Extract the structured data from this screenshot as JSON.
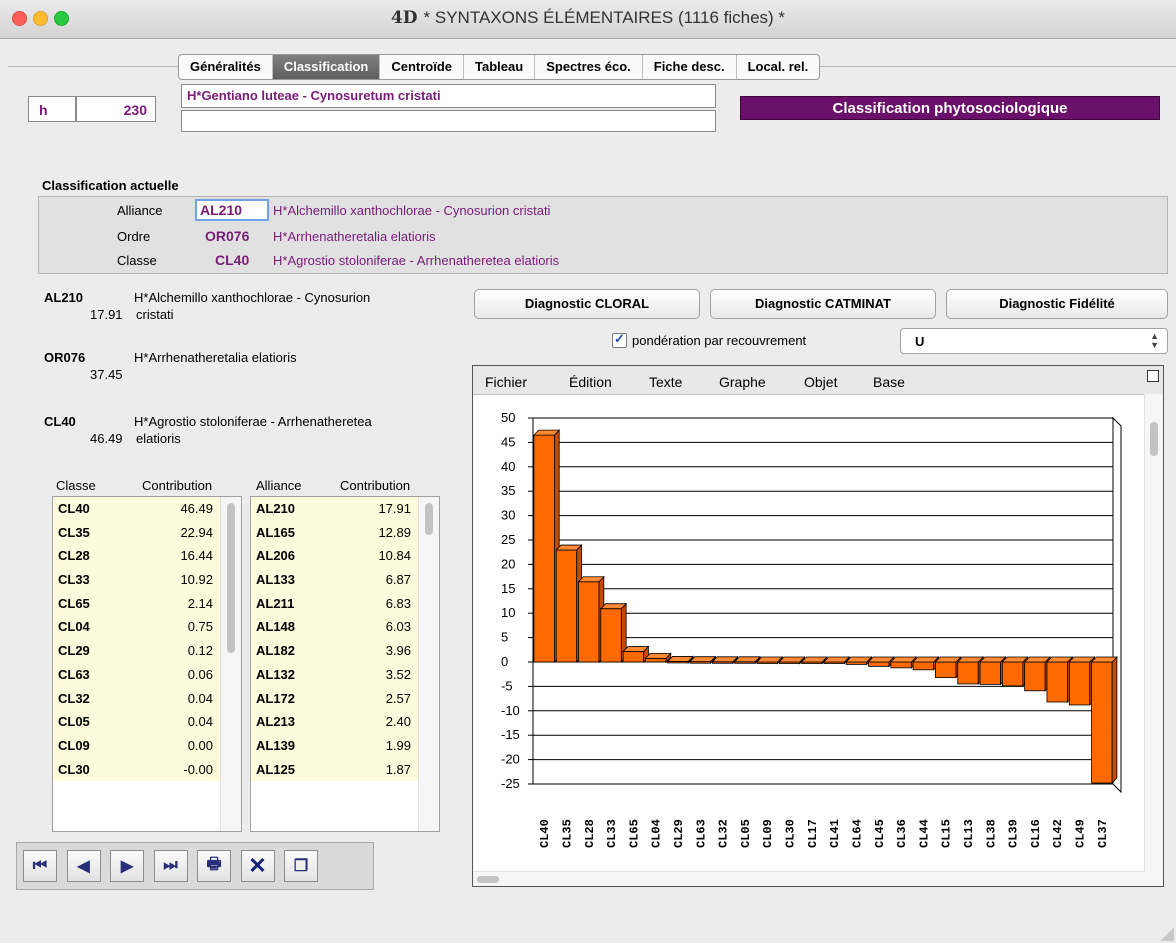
{
  "window": {
    "title": "* SYNTAXONS ÉLÉMENTAIRES (1116 fiches) *",
    "logo": "4D"
  },
  "tabs": [
    {
      "label": "Généralités",
      "active": false
    },
    {
      "label": "Classification",
      "active": true
    },
    {
      "label": "Centroïde",
      "active": false
    },
    {
      "label": "Tableau",
      "active": false
    },
    {
      "label": "Spectres éco.",
      "active": false
    },
    {
      "label": "Fiche desc.",
      "active": false
    },
    {
      "label": "Local. rel.",
      "active": false
    }
  ],
  "record": {
    "prefix": "h",
    "number": "230",
    "name": "H*Gentiano luteae - Cynosuretum cristati",
    "name2": ""
  },
  "banner": "Classification phytosociologique",
  "current": {
    "heading": "Classification actuelle",
    "alliance": {
      "label": "Alliance",
      "code": "AL210",
      "name": "H*Alchemillo xanthochlorae - Cynosurion cristati"
    },
    "ordre": {
      "label": "Ordre",
      "code": "OR076",
      "name": "H*Arrhenatheretalia elatioris"
    },
    "classe": {
      "label": "Classe",
      "code": "CL40",
      "name": "H*Agrostio stoloniferae - Arrhenatheretea elatioris"
    }
  },
  "summary": [
    {
      "code": "AL210",
      "value": "17.91",
      "name1": "H*Alchemillo xanthochlorae - Cynosurion",
      "name2": "cristati"
    },
    {
      "code": "OR076",
      "value": "37.45",
      "name1": "H*Arrhenatheretalia elatioris",
      "name2": ""
    },
    {
      "code": "CL40",
      "value": "46.49",
      "name1": "H*Agrostio stoloniferae - Arrhenatheretea",
      "name2": "elatioris"
    }
  ],
  "buttons": {
    "cloral": "Diagnostic CLORAL",
    "catminat": "Diagnostic CATMINAT",
    "fidelite": "Diagnostic Fidélité"
  },
  "ponderation": {
    "label": "pondération par recouvrement",
    "checked": true
  },
  "select_value": "U",
  "classes_list": {
    "headers": [
      "Classe",
      "Contribution"
    ],
    "rows": [
      [
        "CL40",
        "46.49"
      ],
      [
        "CL35",
        "22.94"
      ],
      [
        "CL28",
        "16.44"
      ],
      [
        "CL33",
        "10.92"
      ],
      [
        "CL65",
        "2.14"
      ],
      [
        "CL04",
        "0.75"
      ],
      [
        "CL29",
        "0.12"
      ],
      [
        "CL63",
        "0.06"
      ],
      [
        "CL32",
        "0.04"
      ],
      [
        "CL05",
        "0.04"
      ],
      [
        "CL09",
        "0.00"
      ],
      [
        "CL30",
        "-0.00"
      ]
    ]
  },
  "alliances_list": {
    "headers": [
      "Alliance",
      "Contribution"
    ],
    "rows": [
      [
        "AL210",
        "17.91"
      ],
      [
        "AL165",
        "12.89"
      ],
      [
        "AL206",
        "10.84"
      ],
      [
        "AL133",
        "6.87"
      ],
      [
        "AL211",
        "6.83"
      ],
      [
        "AL148",
        "6.03"
      ],
      [
        "AL182",
        "3.96"
      ],
      [
        "AL132",
        "3.52"
      ],
      [
        "AL172",
        "2.57"
      ],
      [
        "AL213",
        "2.40"
      ],
      [
        "AL139",
        "1.99"
      ],
      [
        "AL125",
        "1.87"
      ]
    ]
  },
  "chart_menu": [
    "Fichier",
    "Édition",
    "Texte",
    "Graphe",
    "Objet",
    "Base"
  ],
  "chart_data": {
    "type": "bar",
    "categories": [
      "CL40",
      "CL35",
      "CL28",
      "CL33",
      "CL65",
      "CL04",
      "CL29",
      "CL63",
      "CL32",
      "CL05",
      "CL09",
      "CL30",
      "CL17",
      "CL41",
      "CL64",
      "CL45",
      "CL36",
      "CL44",
      "CL15",
      "CL13",
      "CL38",
      "CL39",
      "CL16",
      "CL42",
      "CL49",
      "CL37"
    ],
    "values": [
      46.49,
      22.94,
      16.44,
      10.92,
      2.14,
      0.75,
      0.12,
      0.06,
      0.04,
      0.04,
      0.0,
      -0.0,
      -0.1,
      -0.2,
      -0.5,
      -0.9,
      -1.2,
      -1.6,
      -3.2,
      -4.5,
      -4.6,
      -4.9,
      -5.9,
      -8.2,
      -8.8,
      -24.8
    ],
    "ylim": [
      -25,
      50
    ],
    "yticks": [
      "50",
      "45",
      "40",
      "35",
      "30",
      "25",
      "20",
      "15",
      "10",
      "5",
      "0",
      "-5",
      "-10",
      "-15",
      "-20",
      "-25"
    ],
    "bar_color": "#ff6a00",
    "grid": true
  },
  "toolbar": [
    "first-record",
    "previous-record",
    "next-record",
    "last-record",
    "print",
    "delete",
    "duplicate"
  ]
}
